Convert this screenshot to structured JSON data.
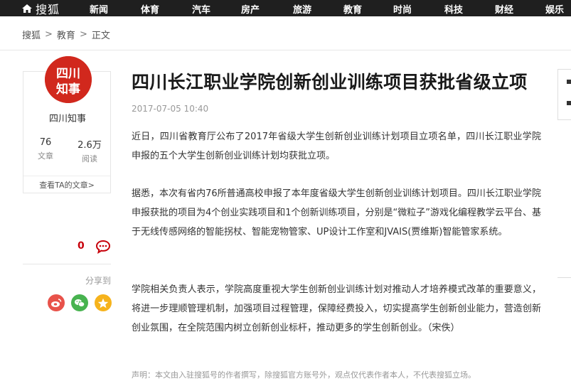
{
  "header": {
    "logo_text": "搜狐",
    "nav": [
      "新闻",
      "体育",
      "汽车",
      "房产",
      "旅游",
      "教育",
      "时尚",
      "科技",
      "财经",
      "娱乐"
    ]
  },
  "breadcrumb": {
    "items": [
      "搜狐",
      "教育",
      "正文"
    ],
    "separator": ">"
  },
  "author": {
    "name": "四川知事",
    "avatar_text_top": "四川",
    "avatar_text_bottom": "知事",
    "stats": [
      {
        "value": "76",
        "label": "文章"
      },
      {
        "value": "2.6万",
        "label": "阅读"
      }
    ],
    "view_articles": "查看TA的文章>"
  },
  "engagement": {
    "comment_count": "0",
    "share_label": "分享到"
  },
  "article": {
    "title": "四川长江职业学院创新创业训练项目获批省级立项",
    "date": "2017-07-05 10:40",
    "paragraphs": [
      "近日，四川省教育厅公布了2017年省级大学生创新创业训练计划项目立项名单，四川长江职业学院申报的五个大学生创新创业训练计划均获批立项。",
      "据悉，本次有省内76所普通高校申报了本年度省级大学生创新创业训练计划项目。四川长江职业学院申报获批的项目为4个创业实践项目和1个创新训练项目，分别是“微粒子”游戏化编程教学云平台、基于无线传感网络的智能拐杖、智能宠物管家、UP设计工作室和JVAIS(贾维斯)智能管家系统。",
      "学院相关负责人表示，学院高度重视大学生创新创业训练计划对推动人才培养模式改革的重要意义，将进一步理顺管理机制，加强项目过程管理，保障经费投入，切实提高学生创新创业能力，营造创新创业氛围，在全院范围内树立创新创业标杆，推动更多的学生创新创业。（宋佚）"
    ],
    "disclaimer": "声明：本文由入驻搜狐号的作者撰写，除搜狐官方账号外，观点仅代表作者本人，不代表搜狐立场。"
  },
  "colors": {
    "topbar": "#1f1f1f",
    "accent_red": "#c7000b",
    "weibo": "#e8524a",
    "wechat": "#47b34f",
    "qzone": "#f6b31c"
  }
}
